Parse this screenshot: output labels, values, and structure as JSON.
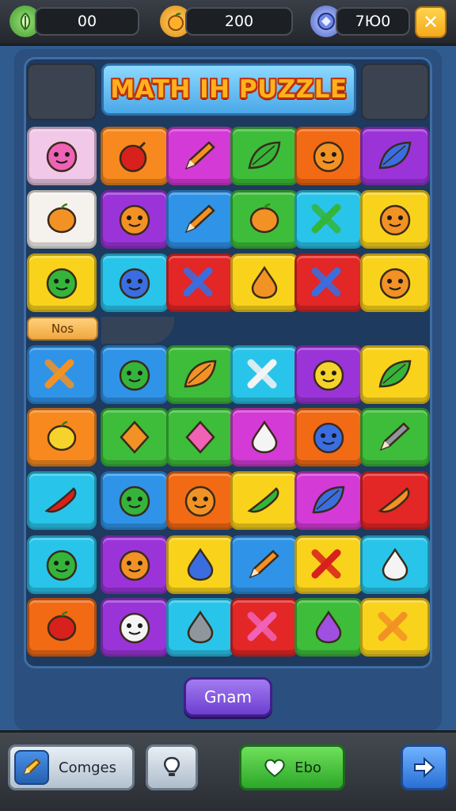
{
  "hud": {
    "lives_value": "00",
    "coins_value": "200",
    "gems_value": "7Ю0",
    "close_label": "✕"
  },
  "title": "MATH IH PUZZLE",
  "tag_label": "Nos",
  "primary_button_label": "Gnam",
  "bottom_bar": {
    "changes_label": "Comges",
    "go_label": "Ebo"
  },
  "colors": {
    "white": "#f5f2ee",
    "orange": "#f7891f",
    "magenta": "#d43ad6",
    "green": "#3dbd3a",
    "orange_dark": "#f26a14",
    "purple": "#9b34d8",
    "blue": "#2f93e8",
    "cyan": "#29c4ea",
    "yellow": "#f9d21b",
    "red": "#e32626",
    "pink": "#f1c8e8"
  },
  "grid": [
    [
      {
        "color": "pink",
        "icon": "pink-blob-creature-icon"
      },
      {
        "color": "orange",
        "icon": "red-bomb-icon"
      },
      {
        "color": "magenta",
        "icon": "pencil-icon"
      },
      {
        "color": "green",
        "icon": "green-leaf-icon"
      },
      {
        "color": "orange_dark",
        "icon": "orange-ghost-creature-icon"
      },
      {
        "color": "purple",
        "icon": "blue-feather-icon"
      }
    ],
    [
      {
        "color": "white",
        "icon": "orange-lemon-icon"
      },
      {
        "color": "purple",
        "icon": "orange-fox-creature-icon"
      },
      {
        "color": "blue",
        "icon": "pencil-icon"
      },
      {
        "color": "green",
        "icon": "orange-fruit-icon"
      },
      {
        "color": "cyan",
        "icon": "green-cross-icon"
      },
      {
        "color": "yellow",
        "icon": "orange-puzzle-creature-icon"
      }
    ],
    [
      {
        "color": "yellow",
        "icon": "green-magnifier-creature-icon"
      },
      {
        "color": "cyan",
        "icon": "blue-flower-creature-icon"
      },
      {
        "color": "red",
        "icon": "blue-cross-icon"
      },
      {
        "color": "yellow",
        "icon": "orange-flask-icon"
      },
      {
        "color": "red",
        "icon": "blue-cross-icon"
      },
      {
        "color": "yellow",
        "icon": "orange-flower-creature-icon"
      }
    ],
    [
      {
        "color": "blue",
        "icon": "orange-cross-icon"
      },
      {
        "color": "blue",
        "icon": "green-alien-creature-icon"
      },
      {
        "color": "green",
        "icon": "orange-leaf-icon"
      },
      {
        "color": "cyan",
        "icon": "white-cross-icon"
      },
      {
        "color": "purple",
        "icon": "yellow-creature-icon"
      },
      {
        "color": "yellow",
        "icon": "green-leaf-icon"
      }
    ],
    [
      {
        "color": "orange",
        "icon": "yellow-lemon-icon"
      },
      {
        "color": "green",
        "icon": "orange-diamond-icon"
      },
      {
        "color": "green",
        "icon": "pink-candy-icon"
      },
      {
        "color": "magenta",
        "icon": "white-drop-icon"
      },
      {
        "color": "orange_dark",
        "icon": "blue-spiky-creature-icon"
      },
      {
        "color": "green",
        "icon": "gray-pencil-icon"
      }
    ],
    [
      {
        "color": "cyan",
        "icon": "red-chili-icon"
      },
      {
        "color": "blue",
        "icon": "green-frog-creature-icon"
      },
      {
        "color": "orange_dark",
        "icon": "orange-ghost-creature-icon"
      },
      {
        "color": "yellow",
        "icon": "green-rocket-icon"
      },
      {
        "color": "magenta",
        "icon": "blue-leaf-icon"
      },
      {
        "color": "red",
        "icon": "orange-pepper-icon"
      }
    ],
    [
      {
        "color": "cyan",
        "icon": "green-turtle-creature-icon"
      },
      {
        "color": "purple",
        "icon": "orange-fox-creature-icon"
      },
      {
        "color": "yellow",
        "icon": "blue-drop-icon"
      },
      {
        "color": "blue",
        "icon": "orange-pencil-icon"
      },
      {
        "color": "yellow",
        "icon": "red-cross-icon"
      },
      {
        "color": "cyan",
        "icon": "white-flask-icon"
      }
    ],
    [
      {
        "color": "orange_dark",
        "icon": "red-tomato-icon"
      },
      {
        "color": "purple",
        "icon": "white-sheep-creature-icon"
      },
      {
        "color": "cyan",
        "icon": "gray-flask-icon"
      },
      {
        "color": "red",
        "icon": "pink-cross-icon"
      },
      {
        "color": "green",
        "icon": "purple-potion-icon"
      },
      {
        "color": "yellow",
        "icon": "orange-cross-icon"
      }
    ]
  ]
}
